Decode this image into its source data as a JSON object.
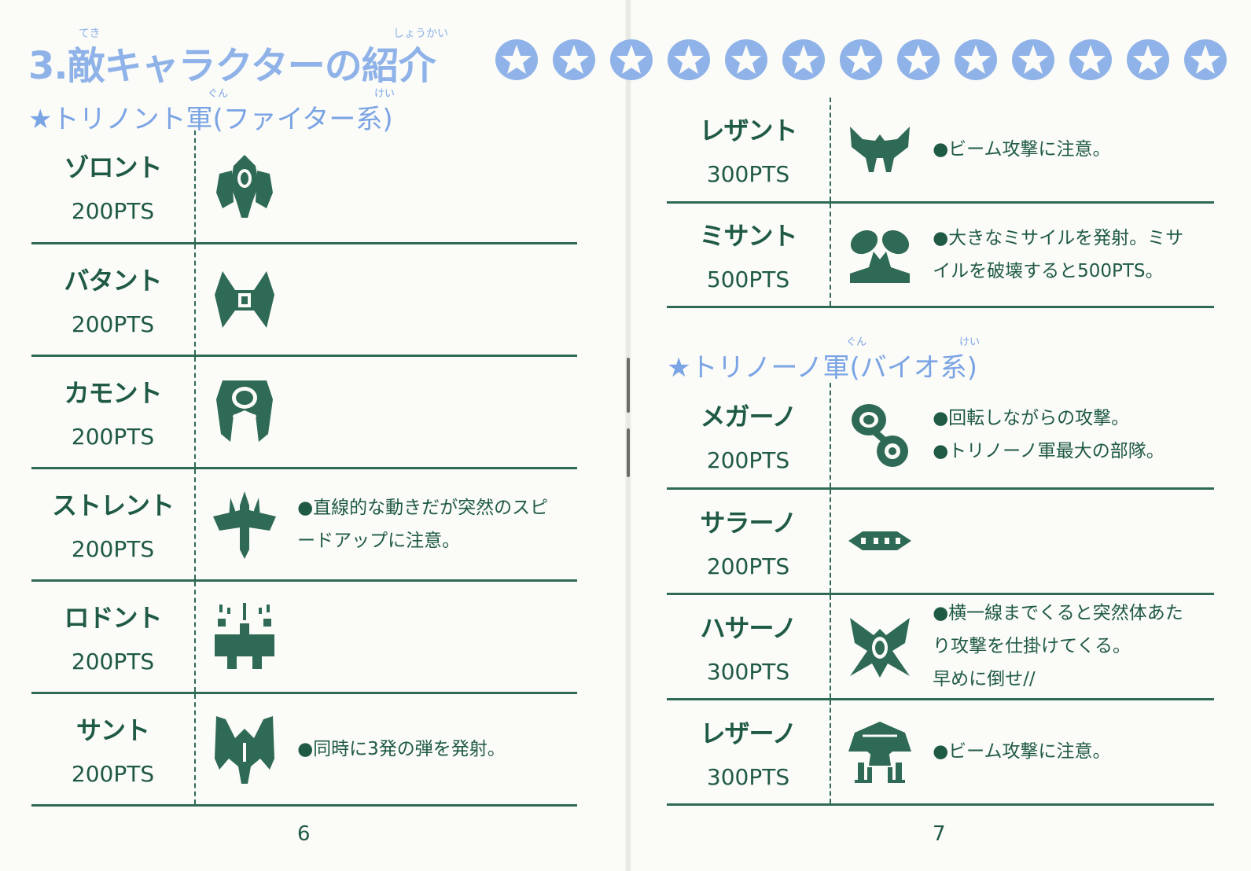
{
  "title": {
    "number": "3.",
    "text": "敵キャラクターの紹介",
    "ruby_teki": "てき",
    "ruby_shoukai": "しょうかい"
  },
  "sections": [
    {
      "heading": "★トリノント軍(ファイター系)",
      "ruby_gun": "ぐん",
      "ruby_kei": "けい",
      "enemies": [
        {
          "name": "ゾロント",
          "points": "200PTS",
          "desc": [],
          "sprite": "zoront"
        },
        {
          "name": "バタント",
          "points": "200PTS",
          "desc": [],
          "sprite": "batant"
        },
        {
          "name": "カモント",
          "points": "200PTS",
          "desc": [],
          "sprite": "kamont"
        },
        {
          "name": "ストレント",
          "points": "200PTS",
          "desc": [
            "●直線的な動きだが突然のスピ",
            "ードアップに注意。"
          ],
          "sprite": "strent"
        },
        {
          "name": "ロドント",
          "points": "200PTS",
          "desc": [],
          "sprite": "rodont"
        },
        {
          "name": "サント",
          "points": "200PTS",
          "desc": [
            "●同時に3発の弾を発射。"
          ],
          "sprite": "sant"
        }
      ]
    },
    {
      "heading": "",
      "enemies": [
        {
          "name": "レザント",
          "points": "300PTS",
          "desc": [
            "●ビーム攻撃に注意。"
          ],
          "sprite": "rezant"
        },
        {
          "name": "ミサント",
          "points": "500PTS",
          "desc": [
            "●大きなミサイルを発射。ミサ",
            "イルを破壊すると500PTS。"
          ],
          "sprite": "misant"
        }
      ]
    },
    {
      "heading": "★トリノーノ軍(バイオ系)",
      "ruby_gun": "ぐん",
      "ruby_kei": "けい",
      "enemies": [
        {
          "name": "メガーノ",
          "points": "200PTS",
          "desc": [
            "●回転しながらの攻撃。",
            "●トリノーノ軍最大の部隊。"
          ],
          "sprite": "megano"
        },
        {
          "name": "サラーノ",
          "points": "200PTS",
          "desc": [],
          "sprite": "sarano"
        },
        {
          "name": "ハサーノ",
          "points": "300PTS",
          "desc": [
            "●横一線までくると突然体あた",
            "り攻撃を仕掛けてくる。",
            "早めに倒せ//"
          ],
          "sprite": "hasano"
        },
        {
          "name": "レザーノ",
          "points": "300PTS",
          "desc": [
            "●ビーム攻撃に注意。"
          ],
          "sprite": "rezano"
        }
      ]
    }
  ],
  "page_numbers": {
    "left": "6",
    "right": "7"
  },
  "colors": {
    "green": "#2e6a55",
    "blue": "#8fb3e8",
    "paper": "#fbfbf8"
  }
}
